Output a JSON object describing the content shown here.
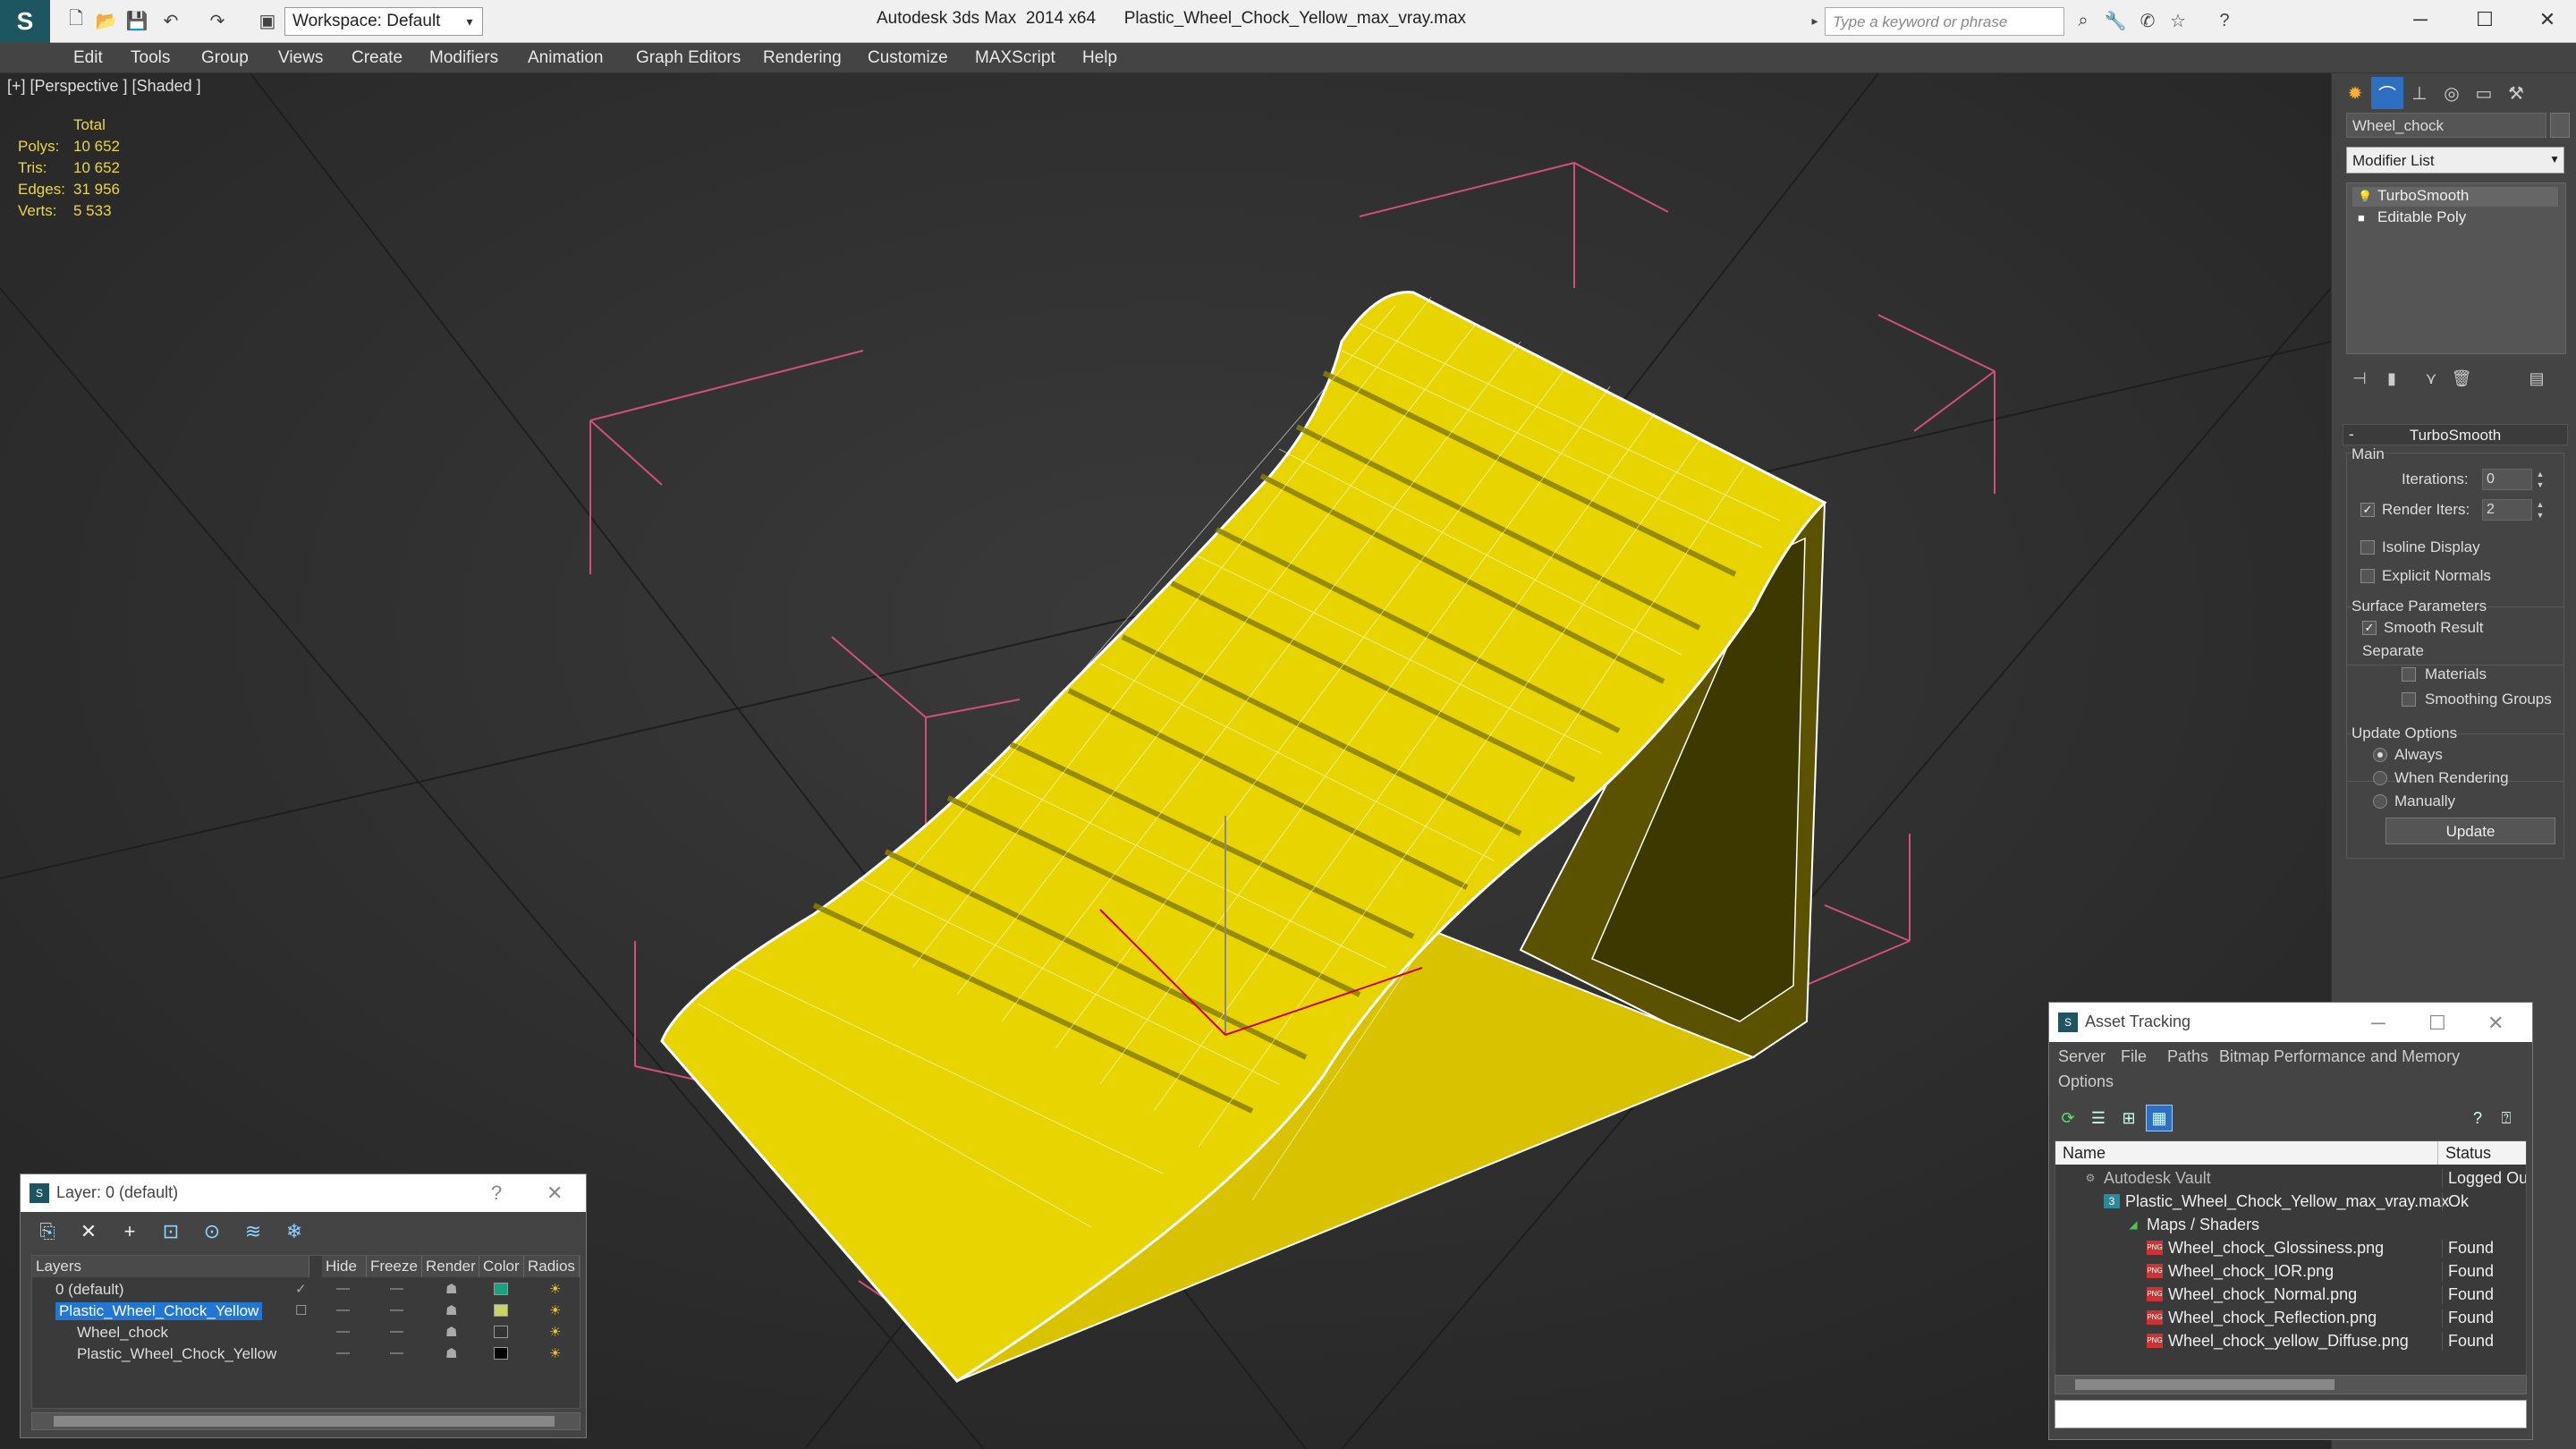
{
  "app": {
    "app_name": "Autodesk 3ds Max  2014 x64",
    "file_name": "Plastic_Wheel_Chock_Yellow_max_vray.max",
    "workspace": "Workspace: Default",
    "search_placeholder": "Type a keyword or phrase"
  },
  "menu": [
    "Edit",
    "Tools",
    "Group",
    "Views",
    "Create",
    "Modifiers",
    "Animation",
    "Graph Editors",
    "Rendering",
    "Customize",
    "MAXScript",
    "Help"
  ],
  "viewport": {
    "label": "[+] [Perspective ] [Shaded ]",
    "stats_header": "Total",
    "stats": [
      {
        "key": "Polys:",
        "value": "10 652"
      },
      {
        "key": "Tris:",
        "value": "10 652"
      },
      {
        "key": "Edges:",
        "value": "31 956"
      },
      {
        "key": "Verts:",
        "value": "5 533"
      }
    ],
    "model_color": "#e8d400",
    "wire_color": "#ffffff",
    "bbox_color": "#e0507a"
  },
  "command_panel": {
    "object_name": "Wheel_chock",
    "modifier_list": "Modifier List",
    "stack": [
      "TurboSmooth",
      "Editable Poly"
    ],
    "turbosmooth": {
      "title": "TurboSmooth",
      "main_label": "Main",
      "iterations_label": "Iterations:",
      "iterations_value": "0",
      "render_iters_label": "Render Iters:",
      "render_iters_value": "2",
      "render_iters_checked": true,
      "isoline_label": "Isoline Display",
      "isoline_checked": false,
      "explicit_normals_label": "Explicit Normals",
      "explicit_normals_checked": false,
      "surface_params_label": "Surface Parameters",
      "smooth_result_label": "Smooth Result",
      "smooth_result_checked": true,
      "separate_label": "Separate",
      "materials_label": "Materials",
      "materials_checked": false,
      "smoothing_groups_label": "Smoothing Groups",
      "smoothing_groups_checked": false,
      "update_options_label": "Update Options",
      "always_label": "Always",
      "when_rendering_label": "When Rendering",
      "manually_label": "Manually",
      "update_mode": "Always",
      "update_button": "Update"
    }
  },
  "layer_dialog": {
    "title": "Layer: 0 (default)",
    "help": "?",
    "close": "✕",
    "columns": [
      "Layers",
      "Hide",
      "Freeze",
      "Render",
      "Color",
      "Radios"
    ],
    "rows": [
      {
        "name": "0 (default)",
        "indent": 1,
        "selected": false,
        "check": "✓",
        "color": "#1aa37a"
      },
      {
        "name": "Plastic_Wheel_Chock_Yellow",
        "indent": 1,
        "selected": true,
        "check": "☐",
        "color": "#c8d46a"
      },
      {
        "name": "Wheel_chock",
        "indent": 2,
        "selected": false,
        "check": "",
        "color": "#333333"
      },
      {
        "name": "Plastic_Wheel_Chock_Yellow",
        "indent": 2,
        "selected": false,
        "check": "",
        "color": "#000000"
      }
    ]
  },
  "asset_tracking": {
    "title": "Asset Tracking",
    "menu": [
      "Server",
      "File",
      "Paths",
      "Bitmap Performance and Memory",
      "Options"
    ],
    "columns": [
      "Name",
      "Status"
    ],
    "rows": [
      {
        "name": "Autodesk Vault",
        "status": "Logged Ou",
        "indent": 0,
        "icon": "vault-icon"
      },
      {
        "name": "Plastic_Wheel_Chock_Yellow_max_vray.max",
        "status": "Ok",
        "indent": 1,
        "icon": "max-file-icon"
      },
      {
        "name": "Maps / Shaders",
        "status": "",
        "indent": 2,
        "icon": "maps-icon"
      },
      {
        "name": "Wheel_chock_Glossiness.png",
        "status": "Found",
        "indent": 3,
        "icon": "png-icon"
      },
      {
        "name": "Wheel_chock_IOR.png",
        "status": "Found",
        "indent": 3,
        "icon": "png-icon"
      },
      {
        "name": "Wheel_chock_Normal.png",
        "status": "Found",
        "indent": 3,
        "icon": "png-icon"
      },
      {
        "name": "Wheel_chock_Reflection.png",
        "status": "Found",
        "indent": 3,
        "icon": "png-icon"
      },
      {
        "name": "Wheel_chock_yellow_Diffuse.png",
        "status": "Found",
        "indent": 3,
        "icon": "png-icon"
      }
    ]
  }
}
